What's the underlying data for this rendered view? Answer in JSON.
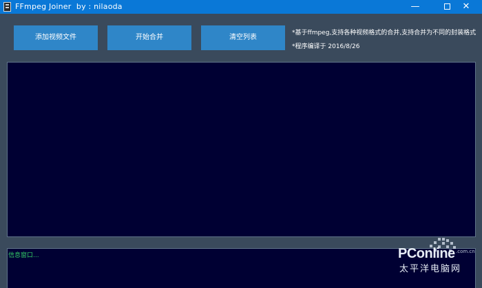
{
  "window": {
    "title": "FFmpeg Joiner  by : nilaoda",
    "minimize_glyph": "—",
    "close_glyph": "✕",
    "icon": "film-icon",
    "accent": "#0a78d7"
  },
  "toolbar": {
    "add_label": "添加视频文件",
    "merge_label": "开始合并",
    "clear_label": "清空列表"
  },
  "info": {
    "line1": "*基于ffmpeg,支持各种视频格式的合并,支持合并为不同的封装格式",
    "line2": "*程序编译于 2016/8/26"
  },
  "log": {
    "text": "信息窗口..."
  },
  "watermark": {
    "brand": "PConline",
    "domain": ".com.cn",
    "cn": "太平洋电脑网"
  },
  "colors": {
    "background": "#3a4a5c",
    "panel": "#000033",
    "button": "#2f86c8",
    "log_text": "#33cc66"
  }
}
